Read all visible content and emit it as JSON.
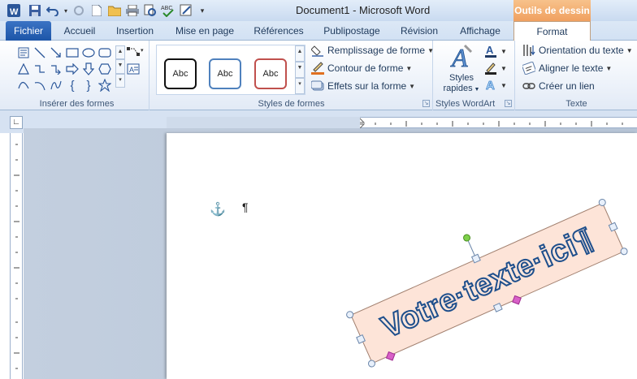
{
  "window": {
    "title": "Document1 - Microsoft Word",
    "context_tab_header": "Outils de dessin"
  },
  "tabs": [
    {
      "label": "Fichier"
    },
    {
      "label": "Accueil"
    },
    {
      "label": "Insertion"
    },
    {
      "label": "Mise en page"
    },
    {
      "label": "Références"
    },
    {
      "label": "Publipostage"
    },
    {
      "label": "Révision"
    },
    {
      "label": "Affichage"
    },
    {
      "label": "Format"
    }
  ],
  "ribbon": {
    "insert_shapes": {
      "label": "Insérer des formes"
    },
    "shape_styles": {
      "label": "Styles de formes",
      "sample": "Abc",
      "fill": "Remplissage de forme",
      "outline": "Contour de forme",
      "effects": "Effets sur la forme"
    },
    "wordart": {
      "label": "Styles WordArt",
      "quick_styles_line1": "Styles",
      "quick_styles_line2": "rapides"
    },
    "text": {
      "label": "Texte",
      "orientation": "Orientation du texte",
      "align": "Aligner le texte",
      "link": "Créer un lien"
    }
  },
  "document": {
    "wordart_text": "Votre·texte·ici¶",
    "paragraph_mark": "¶"
  },
  "colors": {
    "accent": "#2b579a",
    "context_orange": "#f0a060",
    "wordart_fill": "#fde4d8",
    "wordart_outline": "#1e4f8c"
  }
}
